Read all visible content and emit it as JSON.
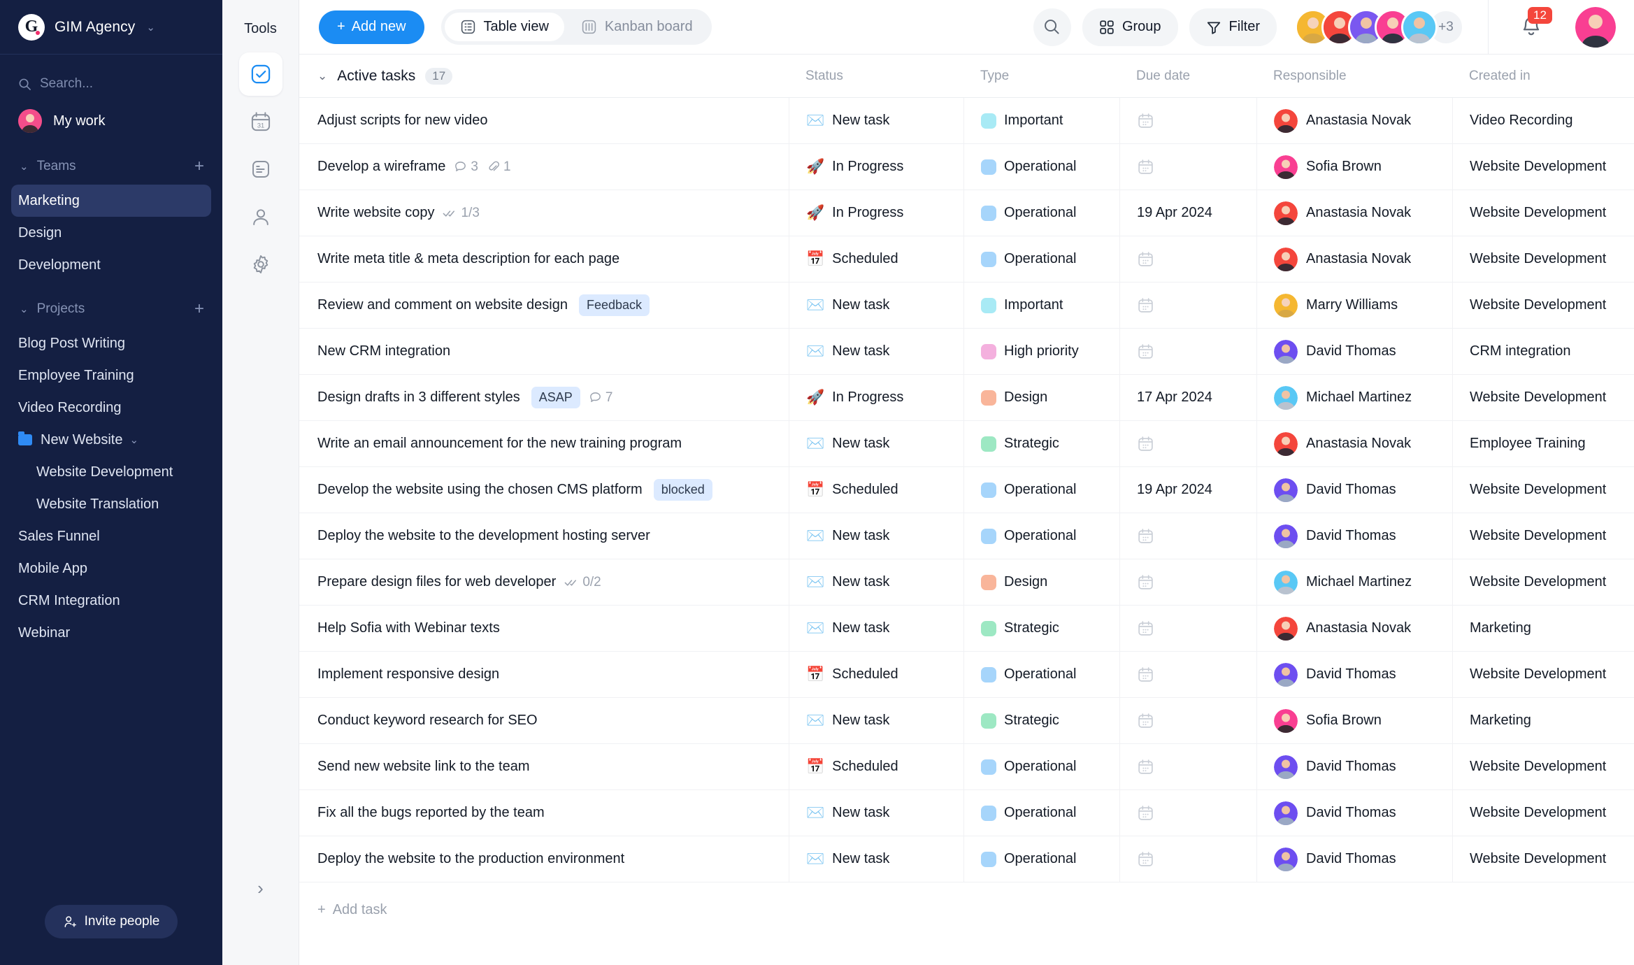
{
  "sidebar": {
    "brand": {
      "name": "GIM Agency",
      "logo_letter": "G",
      "caret": "⌄"
    },
    "search": {
      "placeholder": "Search...",
      "icon": "search-icon"
    },
    "my_work": {
      "label": "My work",
      "avatar_color": "#f44d8a"
    },
    "teams": {
      "title": "Teams",
      "add": "+",
      "items": [
        {
          "label": "Marketing",
          "active": true
        },
        {
          "label": "Design",
          "active": false
        },
        {
          "label": "Development",
          "active": false
        }
      ]
    },
    "projects": {
      "title": "Projects",
      "add": "+",
      "items": [
        {
          "label": "Blog Post Writing",
          "type": "project"
        },
        {
          "label": "Employee Training",
          "type": "project"
        },
        {
          "label": "Video Recording",
          "type": "project"
        },
        {
          "label": "New Website",
          "type": "folder",
          "caret": "⌄"
        },
        {
          "label": "Website Development",
          "type": "child"
        },
        {
          "label": "Website Translation",
          "type": "child"
        },
        {
          "label": "Sales Funnel",
          "type": "project"
        },
        {
          "label": "Mobile App",
          "type": "project"
        },
        {
          "label": "CRM Integration",
          "type": "project"
        },
        {
          "label": "Webinar",
          "type": "project"
        }
      ]
    },
    "invite": {
      "label": "Invite people",
      "icon": "add-person-icon"
    }
  },
  "rail": {
    "title": "Tools",
    "items": [
      {
        "icon": "checkbox-icon",
        "active": true
      },
      {
        "icon": "calendar-icon",
        "active": false
      },
      {
        "icon": "notes-icon",
        "active": false
      },
      {
        "icon": "person-icon",
        "active": false
      },
      {
        "icon": "gear-icon",
        "active": false
      }
    ],
    "collapse": "›"
  },
  "toolbar": {
    "add_new_label": "Add new",
    "add_new_plus": "+",
    "views": [
      {
        "label": "Table view",
        "icon": "table-icon",
        "active": true
      },
      {
        "label": "Kanban board",
        "icon": "kanban-icon",
        "active": false
      }
    ],
    "search_icon": "search-icon",
    "group_label": "Group",
    "filter_label": "Filter",
    "avatars": [
      {
        "color": "#f5b731"
      },
      {
        "color": "#f4463c"
      },
      {
        "color": "#7a58f0"
      },
      {
        "color": "#f93f92"
      },
      {
        "color": "#59c8f5"
      }
    ],
    "avatar_overflow": "+3",
    "notifications_count": "12",
    "me_avatar_color": "#f93f92"
  },
  "table": {
    "group": {
      "title": "Active tasks",
      "count": "17",
      "caret": "⌄"
    },
    "columns": [
      "Status",
      "Type",
      "Due date",
      "Responsible",
      "Created in"
    ],
    "settings_icon": "gear-icon",
    "add_task_label": "Add task",
    "add_task_plus": "+",
    "type_colors": {
      "Important": "#a8eaf5",
      "Operational": "#a6d5fb",
      "High priority": "#f4b0de",
      "Design": "#f9b59a",
      "Strategic": "#9de8c3"
    },
    "status_emoji": {
      "New task": "✉️",
      "In Progress": "🚀",
      "Scheduled": "📅"
    },
    "people_colors": {
      "Anastasia Novak": "#f4463c",
      "Sofia Brown": "#f93f92",
      "Marry Williams": "#f5b731",
      "David Thomas": "#6d4ef0",
      "Michael Martinez": "#59c8f5"
    },
    "rows": [
      {
        "task": "Adjust scripts for new video",
        "badge": "",
        "comments": "",
        "attachments": "",
        "subtasks": "",
        "status": "New task",
        "type": "Important",
        "due": "",
        "responsible": "Anastasia Novak",
        "created": "Video Recording"
      },
      {
        "task": "Develop a wireframe",
        "badge": "",
        "comments": "3",
        "attachments": "1",
        "subtasks": "",
        "status": "In Progress",
        "type": "Operational",
        "due": "",
        "responsible": "Sofia Brown",
        "created": "Website Development"
      },
      {
        "task": "Write website copy",
        "badge": "",
        "comments": "",
        "attachments": "",
        "subtasks": "1/3",
        "status": "In Progress",
        "type": "Operational",
        "due": "19 Apr 2024",
        "responsible": "Anastasia Novak",
        "created": "Website Development"
      },
      {
        "task": "Write meta title & meta description for each page",
        "badge": "",
        "comments": "",
        "attachments": "",
        "subtasks": "",
        "status": "Scheduled",
        "type": "Operational",
        "due": "",
        "responsible": "Anastasia Novak",
        "created": "Website Development"
      },
      {
        "task": "Review and comment on website design",
        "badge": "Feedback",
        "comments": "",
        "attachments": "",
        "subtasks": "",
        "status": "New task",
        "type": "Important",
        "due": "",
        "responsible": "Marry Williams",
        "created": "Website Development"
      },
      {
        "task": "New CRM integration",
        "badge": "",
        "comments": "",
        "attachments": "",
        "subtasks": "",
        "status": "New task",
        "type": "High priority",
        "due": "",
        "responsible": "David Thomas",
        "created": "CRM integration"
      },
      {
        "task": "Design drafts in 3 different styles",
        "badge": "ASAP",
        "comments": "7",
        "attachments": "",
        "subtasks": "",
        "status": "In Progress",
        "type": "Design",
        "due": "17 Apr 2024",
        "responsible": "Michael Martinez",
        "created": "Website Development"
      },
      {
        "task": "Write an email announcement for the new training program",
        "badge": "",
        "comments": "",
        "attachments": "",
        "subtasks": "",
        "status": "New task",
        "type": "Strategic",
        "due": "",
        "responsible": "Anastasia Novak",
        "created": "Employee Training"
      },
      {
        "task": "Develop the website using the chosen CMS platform",
        "badge": "blocked",
        "comments": "",
        "attachments": "",
        "subtasks": "",
        "status": "Scheduled",
        "type": "Operational",
        "due": "19 Apr 2024",
        "responsible": "David Thomas",
        "created": "Website Development"
      },
      {
        "task": "Deploy the website to the development hosting server",
        "badge": "",
        "comments": "",
        "attachments": "",
        "subtasks": "",
        "status": "New task",
        "type": "Operational",
        "due": "",
        "responsible": "David Thomas",
        "created": "Website Development"
      },
      {
        "task": "Prepare design files for web developer",
        "badge": "",
        "comments": "",
        "attachments": "",
        "subtasks": "0/2",
        "status": "New task",
        "type": "Design",
        "due": "",
        "responsible": "Michael Martinez",
        "created": "Website Development"
      },
      {
        "task": "Help Sofia with Webinar texts",
        "badge": "",
        "comments": "",
        "attachments": "",
        "subtasks": "",
        "status": "New task",
        "type": "Strategic",
        "due": "",
        "responsible": "Anastasia Novak",
        "created": "Marketing"
      },
      {
        "task": "Implement responsive design",
        "badge": "",
        "comments": "",
        "attachments": "",
        "subtasks": "",
        "status": "Scheduled",
        "type": "Operational",
        "due": "",
        "responsible": "David Thomas",
        "created": "Website Development"
      },
      {
        "task": "Conduct keyword research for SEO",
        "badge": "",
        "comments": "",
        "attachments": "",
        "subtasks": "",
        "status": "New task",
        "type": "Strategic",
        "due": "",
        "responsible": "Sofia Brown",
        "created": "Marketing"
      },
      {
        "task": "Send new website link to the team",
        "badge": "",
        "comments": "",
        "attachments": "",
        "subtasks": "",
        "status": "Scheduled",
        "type": "Operational",
        "due": "",
        "responsible": "David Thomas",
        "created": "Website Development"
      },
      {
        "task": "Fix all the bugs reported by the team",
        "badge": "",
        "comments": "",
        "attachments": "",
        "subtasks": "",
        "status": "New task",
        "type": "Operational",
        "due": "",
        "responsible": "David Thomas",
        "created": "Website Development"
      },
      {
        "task": "Deploy the website to the production environment",
        "badge": "",
        "comments": "",
        "attachments": "",
        "subtasks": "",
        "status": "New task",
        "type": "Operational",
        "due": "",
        "responsible": "David Thomas",
        "created": "Website Development"
      }
    ]
  }
}
